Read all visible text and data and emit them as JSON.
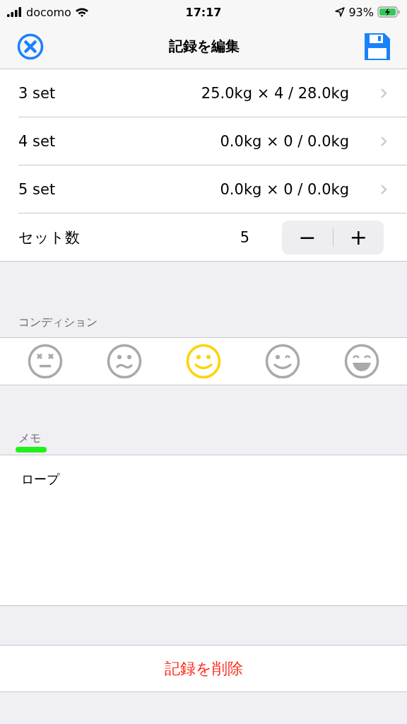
{
  "status_bar": {
    "carrier": "docomo",
    "time": "17:17",
    "battery": "93%",
    "charging": true
  },
  "nav": {
    "title": "記録を編集"
  },
  "sets": [
    {
      "label": "3 set",
      "value": "25.0kg × 4 / 28.0kg"
    },
    {
      "label": "4 set",
      "value": "0.0kg × 0 / 0.0kg"
    },
    {
      "label": "5 set",
      "value": "0.0kg × 0 / 0.0kg"
    }
  ],
  "set_count": {
    "label": "セット数",
    "value": "5",
    "minus": "−",
    "plus": "+"
  },
  "condition": {
    "header": "コンディション",
    "faces": [
      {
        "kind": "dizzy",
        "selected": false
      },
      {
        "kind": "uneasy",
        "selected": false
      },
      {
        "kind": "smile",
        "selected": true
      },
      {
        "kind": "wink",
        "selected": false
      },
      {
        "kind": "grin",
        "selected": false
      }
    ]
  },
  "memo": {
    "header": "メモ",
    "highlighted": true,
    "value": "ロープ"
  },
  "delete_button": "記録を削除"
}
